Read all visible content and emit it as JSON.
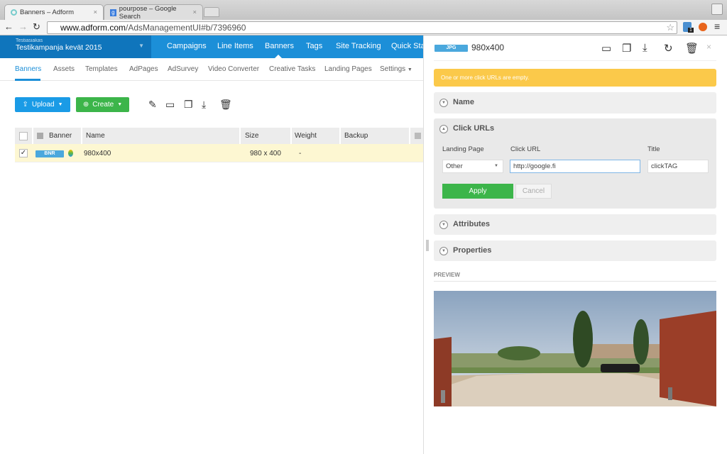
{
  "browser": {
    "tabs": [
      {
        "title": "Banners – Adform",
        "close": "×"
      },
      {
        "title": "pourpose – Google Search",
        "close": "×"
      }
    ],
    "url_host": "www.adform.com",
    "url_path": "/AdsManagementUI#b/7396960",
    "extension_badge": "1"
  },
  "app": {
    "account_client": "Testiasiakas",
    "account_campaign": "Testikampanja kevät 2015",
    "nav": [
      "Campaigns",
      "Line Items",
      "Banners",
      "Tags",
      "Site Tracking",
      "Quick Stat"
    ],
    "active_nav": "Banners",
    "subnav": [
      "Banners",
      "Assets",
      "Templates",
      "AdPages",
      "AdSurvey",
      "Video Converter",
      "Creative Tasks",
      "Landing Pages",
      "Settings"
    ],
    "active_subnav": "Banners"
  },
  "toolbar": {
    "upload": "Upload",
    "create": "Create"
  },
  "table": {
    "columns": [
      "Banner",
      "Name",
      "Size",
      "Weight",
      "Backup"
    ],
    "rows": [
      {
        "checked": true,
        "badge": "BNR",
        "name": "980x400",
        "size": "980 x 400",
        "weight": "-",
        "backup": ""
      }
    ]
  },
  "panel": {
    "badge": "JPG",
    "title": "980x400",
    "close": "×",
    "alert": "One or more click URLs are empty.",
    "sections": {
      "name": "Name",
      "click_urls": "Click URLs",
      "attributes": "Attributes",
      "properties": "Properties"
    },
    "click_urls": {
      "landing_page_label": "Landing Page",
      "click_url_label": "Click URL",
      "title_label": "Title",
      "landing_page_value": "Other",
      "click_url_value": "http://google.fi",
      "title_value": "clickTAG",
      "apply": "Apply",
      "cancel": "Cancel"
    },
    "preview_label": "PREVIEW"
  },
  "colors": {
    "brand_blue": "#1c8fd8",
    "create_green": "#3cb54a",
    "upload_blue": "#1a9be6",
    "alert_yellow": "#fbc94a",
    "row_highlight": "#fdf7d2"
  }
}
